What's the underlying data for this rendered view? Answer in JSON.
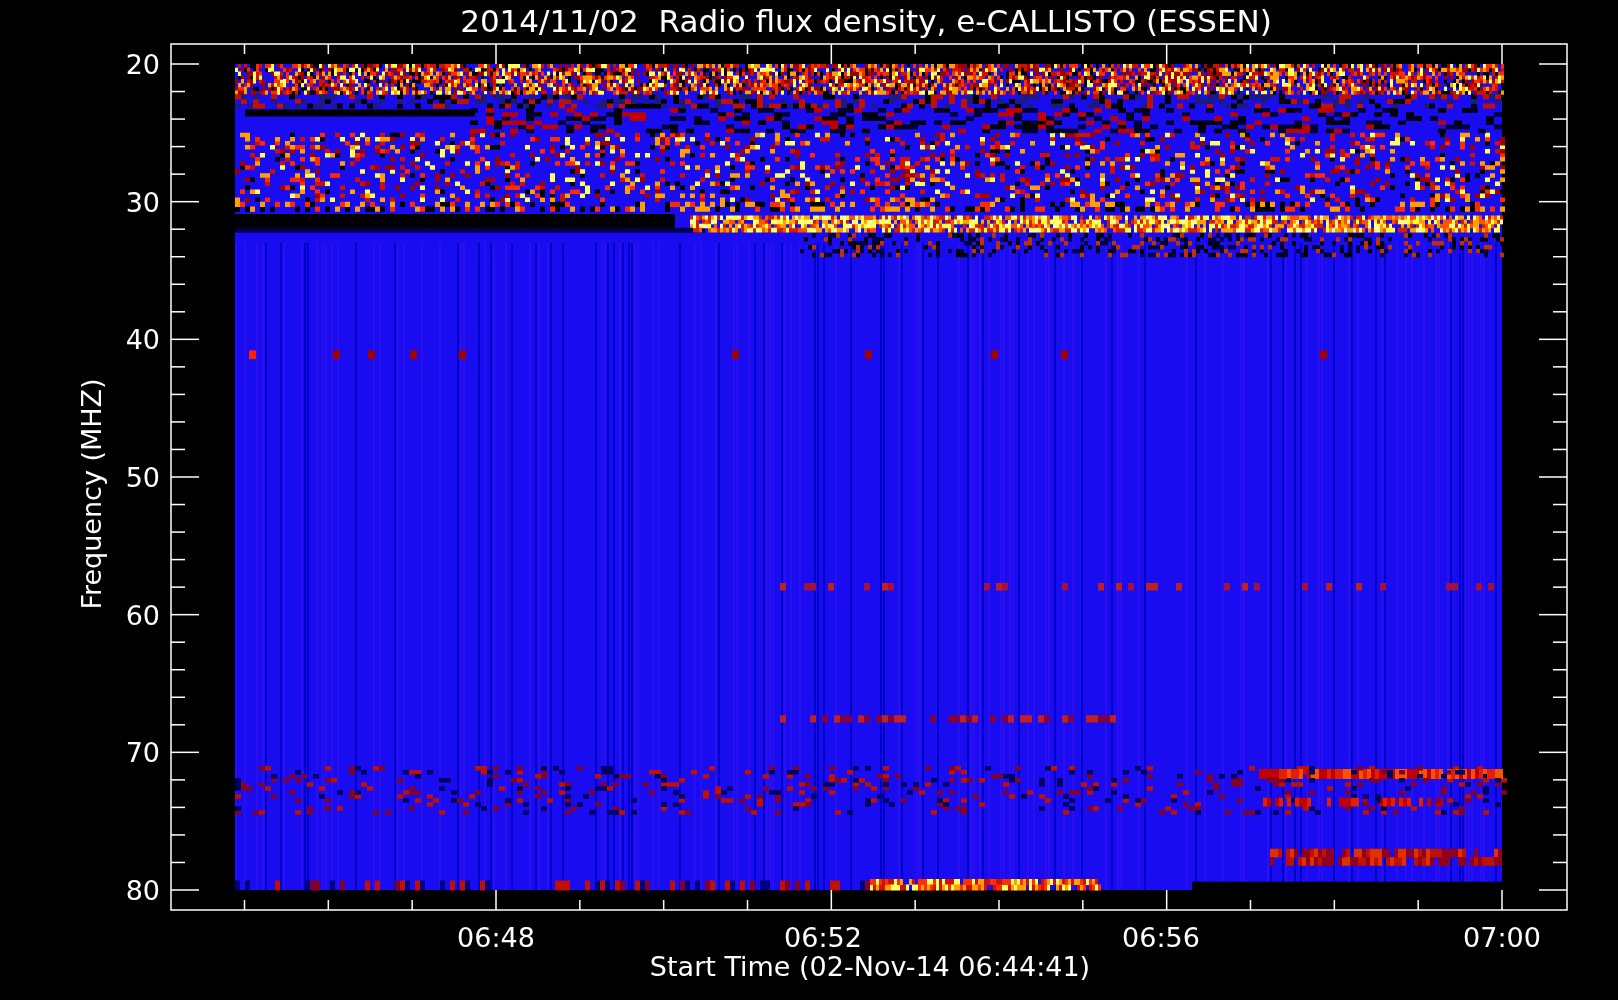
{
  "plot": {
    "title": "2014/11/02  Radio flux density, e-CALLISTO (ESSEN)",
    "ylabel": "Frequency (MHZ)",
    "xlabel": "Start Time (02-Nov-14 06:44:41)",
    "yticks": [
      "20",
      "30",
      "40",
      "50",
      "60",
      "70",
      "80"
    ],
    "xticks": [
      "06:48",
      "06:52",
      "06:56",
      "07:00"
    ]
  }
}
